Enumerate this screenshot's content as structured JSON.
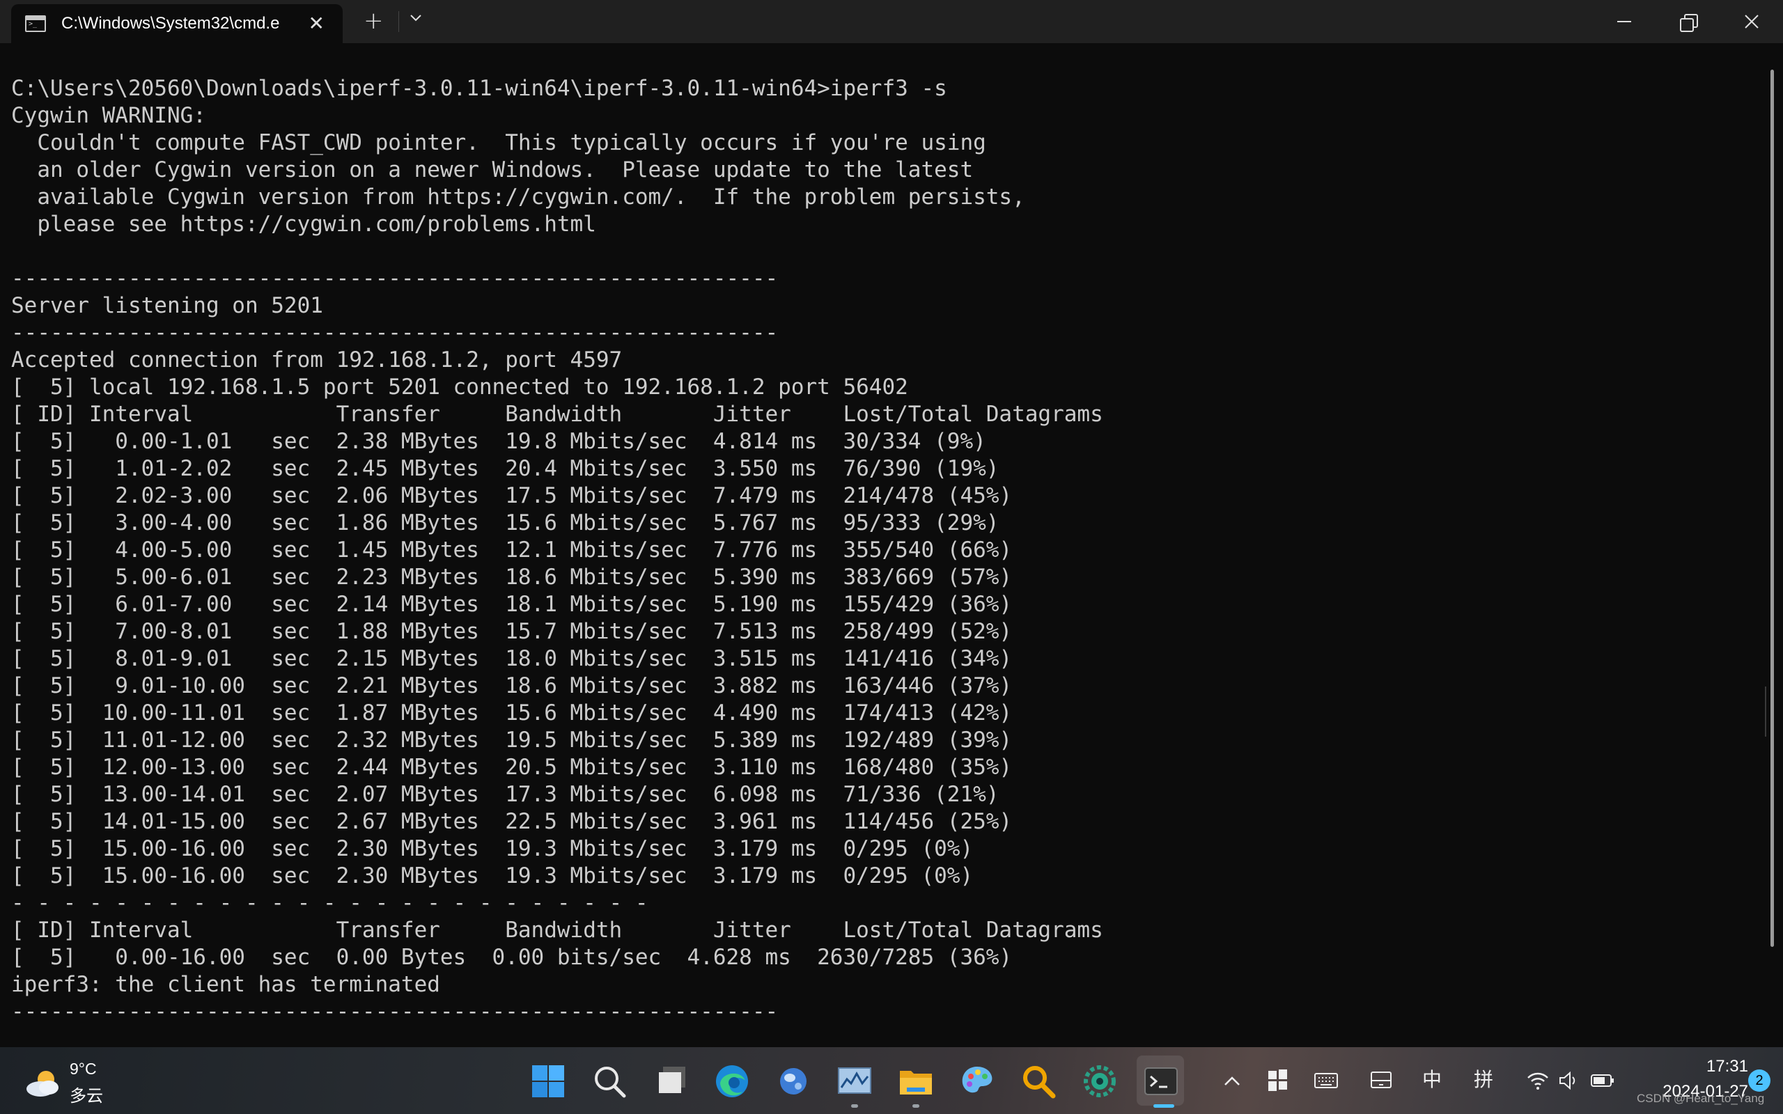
{
  "window": {
    "tab_title": "C:\\Windows\\System32\\cmd.e",
    "tab_close_glyph": "✕",
    "new_tab_glyph": "+"
  },
  "terminal": {
    "lines": [
      "C:\\Users\\20560\\Downloads\\iperf-3.0.11-win64\\iperf-3.0.11-win64>iperf3 -s",
      "Cygwin WARNING:",
      "  Couldn't compute FAST_CWD pointer.  This typically occurs if you're using",
      "  an older Cygwin version on a newer Windows.  Please update to the latest",
      "  available Cygwin version from https://cygwin.com/.  If the problem persists,",
      "  please see https://cygwin.com/problems.html",
      "",
      "-----------------------------------------------------------",
      "Server listening on 5201",
      "-----------------------------------------------------------",
      "Accepted connection from 192.168.1.2, port 4597",
      "[  5] local 192.168.1.5 port 5201 connected to 192.168.1.2 port 56402",
      "[ ID] Interval           Transfer     Bandwidth       Jitter    Lost/Total Datagrams",
      "[  5]   0.00-1.01   sec  2.38 MBytes  19.8 Mbits/sec  4.814 ms  30/334 (9%)",
      "[  5]   1.01-2.02   sec  2.45 MBytes  20.4 Mbits/sec  3.550 ms  76/390 (19%)",
      "[  5]   2.02-3.00   sec  2.06 MBytes  17.5 Mbits/sec  7.479 ms  214/478 (45%)",
      "[  5]   3.00-4.00   sec  1.86 MBytes  15.6 Mbits/sec  5.767 ms  95/333 (29%)",
      "[  5]   4.00-5.00   sec  1.45 MBytes  12.1 Mbits/sec  7.776 ms  355/540 (66%)",
      "[  5]   5.00-6.01   sec  2.23 MBytes  18.6 Mbits/sec  5.390 ms  383/669 (57%)",
      "[  5]   6.01-7.00   sec  2.14 MBytes  18.1 Mbits/sec  5.190 ms  155/429 (36%)",
      "[  5]   7.00-8.01   sec  1.88 MBytes  15.7 Mbits/sec  7.513 ms  258/499 (52%)",
      "[  5]   8.01-9.01   sec  2.15 MBytes  18.0 Mbits/sec  3.515 ms  141/416 (34%)",
      "[  5]   9.01-10.00  sec  2.21 MBytes  18.6 Mbits/sec  3.882 ms  163/446 (37%)",
      "[  5]  10.00-11.01  sec  1.87 MBytes  15.6 Mbits/sec  4.490 ms  174/413 (42%)",
      "[  5]  11.01-12.00  sec  2.32 MBytes  19.5 Mbits/sec  5.389 ms  192/489 (39%)",
      "[  5]  12.00-13.00  sec  2.44 MBytes  20.5 Mbits/sec  3.110 ms  168/480 (35%)",
      "[  5]  13.00-14.01  sec  2.07 MBytes  17.3 Mbits/sec  6.098 ms  71/336 (21%)",
      "[  5]  14.01-15.00  sec  2.67 MBytes  22.5 Mbits/sec  3.961 ms  114/456 (25%)",
      "[  5]  15.00-16.00  sec  2.30 MBytes  19.3 Mbits/sec  3.179 ms  0/295 (0%)",
      "[  5]  15.00-16.00  sec  2.30 MBytes  19.3 Mbits/sec  3.179 ms  0/295 (0%)",
      "- - - - - - - - - - - - - - - - - - - - - - - - -",
      "[ ID] Interval           Transfer     Bandwidth       Jitter    Lost/Total Datagrams",
      "[  5]   0.00-16.00  sec  0.00 Bytes  0.00 bits/sec  4.628 ms  2630/7285 (36%)",
      "iperf3: the client has terminated",
      "-----------------------------------------------------------"
    ]
  },
  "taskbar": {
    "weather": {
      "temp": "9°C",
      "desc": "多云"
    },
    "tray": {
      "input_method_1": "中",
      "input_method_2": "拼"
    },
    "clock": {
      "time": "17:31",
      "date": "2024-01-27"
    },
    "notification_count": "2",
    "watermark": "CSDN @Heart_to_Yang"
  }
}
